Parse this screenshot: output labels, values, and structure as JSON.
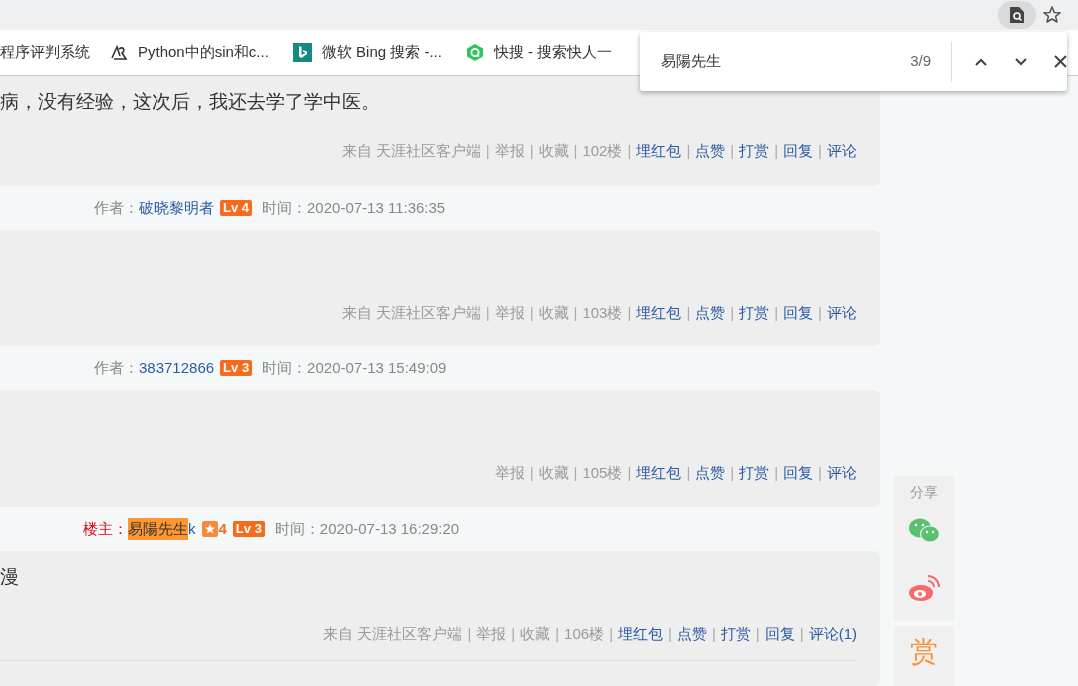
{
  "bookmarks": [
    {
      "label": "程序评判系统",
      "kind": "none"
    },
    {
      "label": "Python中的sin和c...",
      "kind": "pen"
    },
    {
      "label": "微软 Bing 搜索 -...",
      "kind": "bing"
    },
    {
      "label": "快搜 - 搜索快人一",
      "kind": "q"
    }
  ],
  "find_bar": {
    "query": "易陽先生",
    "count": "3/9"
  },
  "posts": [
    {
      "body": "病，没有经验，这次后，我还去学了学中医。",
      "footer": [
        {
          "text": "来自 天涯社区客户端",
          "kind": "plain"
        },
        {
          "text": "举报",
          "kind": "plain"
        },
        {
          "text": "收藏",
          "kind": "plain"
        },
        {
          "text": "102楼",
          "kind": "plain"
        },
        {
          "text": "埋红包",
          "kind": "link"
        },
        {
          "text": "点赞",
          "kind": "link"
        },
        {
          "text": "打赏",
          "kind": "link"
        },
        {
          "text": "回复",
          "kind": "link"
        },
        {
          "text": "评论",
          "kind": "link"
        }
      ],
      "divider": false
    },
    {
      "author": {
        "role": "作者：",
        "kind": "author",
        "name": [
          {
            "text": "破晓黎明者",
            "highlighted": false
          }
        ],
        "level": "Lv 4",
        "time": "时间：2020-07-13 11:36:35"
      }
    },
    {
      "footer": [
        {
          "text": "来自 天涯社区客户端",
          "kind": "plain"
        },
        {
          "text": "举报",
          "kind": "plain"
        },
        {
          "text": "收藏",
          "kind": "plain"
        },
        {
          "text": "103楼",
          "kind": "plain"
        },
        {
          "text": "埋红包",
          "kind": "link"
        },
        {
          "text": "点赞",
          "kind": "link"
        },
        {
          "text": "打赏",
          "kind": "link"
        },
        {
          "text": "回复",
          "kind": "link"
        },
        {
          "text": "评论",
          "kind": "link"
        }
      ],
      "divider": false
    },
    {
      "author": {
        "role": "作者：",
        "kind": "author",
        "name": [
          {
            "text": "383712866",
            "highlighted": false
          }
        ],
        "level": "Lv 3",
        "time": "时间：2020-07-13 15:49:09"
      }
    },
    {
      "footer": [
        {
          "text": "举报",
          "kind": "plain"
        },
        {
          "text": "收藏",
          "kind": "plain"
        },
        {
          "text": "105楼",
          "kind": "plain"
        },
        {
          "text": "埋红包",
          "kind": "link"
        },
        {
          "text": "点赞",
          "kind": "link"
        },
        {
          "text": "打赏",
          "kind": "link"
        },
        {
          "text": "回复",
          "kind": "link"
        },
        {
          "text": "评论",
          "kind": "link"
        }
      ],
      "divider": false
    },
    {
      "author": {
        "role": "楼主：",
        "kind": "op",
        "name": [
          {
            "text": "易陽先生",
            "highlighted": true
          },
          {
            "text": "k",
            "highlighted": false
          }
        ],
        "badge_count": "4",
        "level": "Lv 3",
        "time": "时间：2020-07-13 16:29:20"
      }
    },
    {
      "body": "漫",
      "footer": [
        {
          "text": "来自 天涯社区客户端",
          "kind": "plain"
        },
        {
          "text": "举报",
          "kind": "plain"
        },
        {
          "text": "收藏",
          "kind": "plain"
        },
        {
          "text": "106楼",
          "kind": "plain"
        },
        {
          "text": "埋红包",
          "kind": "link"
        },
        {
          "text": "点赞",
          "kind": "link"
        },
        {
          "text": "打赏",
          "kind": "link"
        },
        {
          "text": "回复",
          "kind": "link"
        },
        {
          "text": "评论(1)",
          "kind": "link"
        }
      ],
      "divider": true
    }
  ],
  "separator": "|",
  "share": {
    "title": "分享",
    "reward": "赏"
  }
}
